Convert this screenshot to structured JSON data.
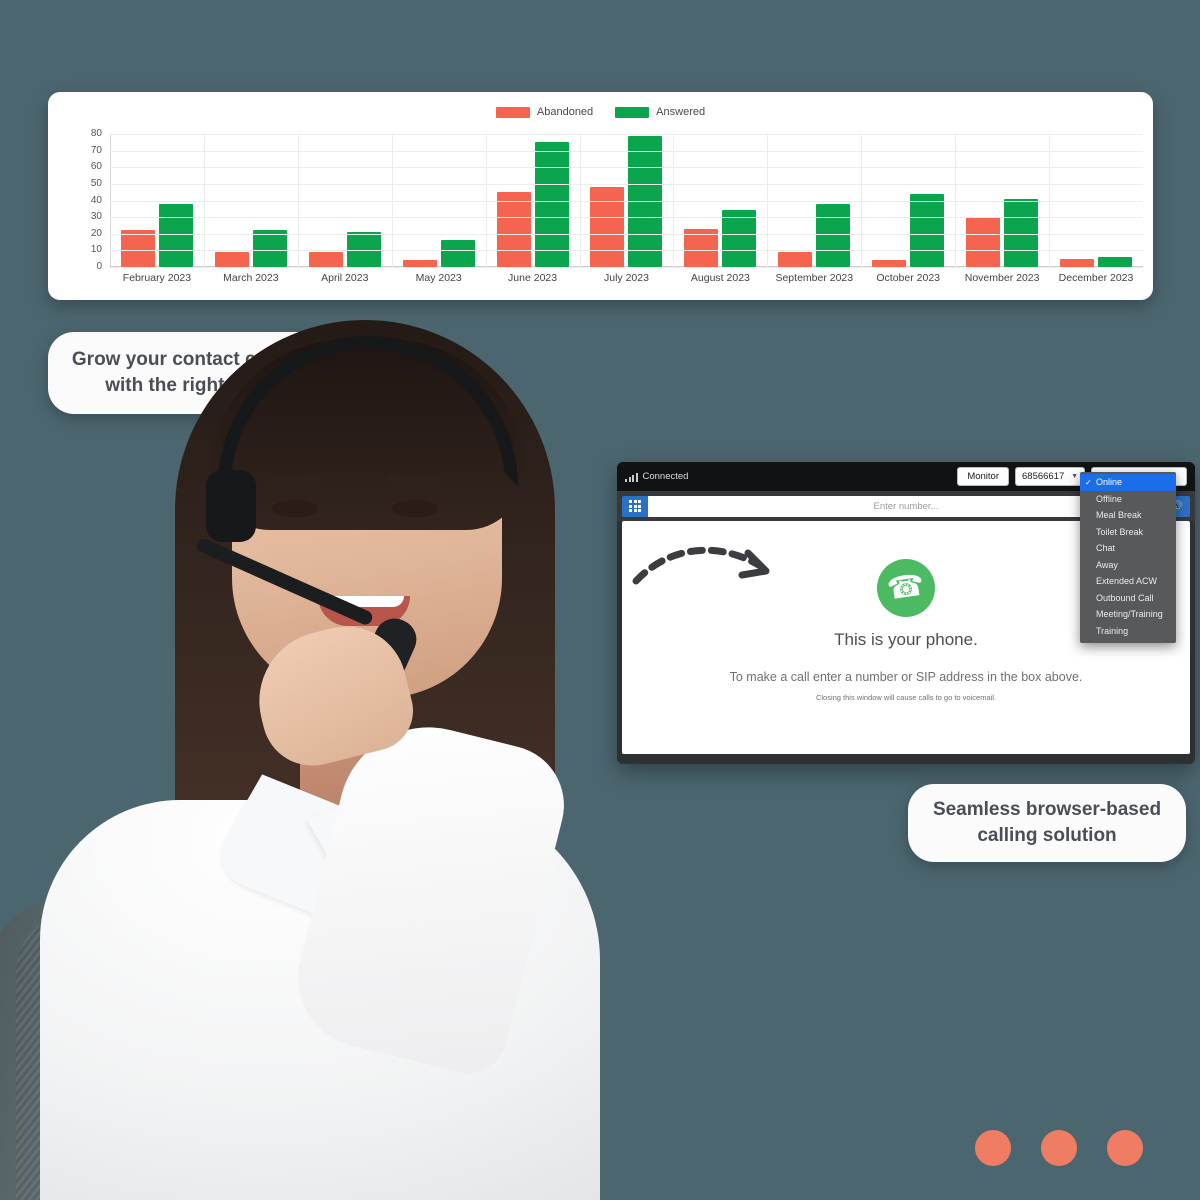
{
  "page": {
    "background_color": "#4c6670",
    "accent_color": "#ee7d63"
  },
  "chart_data": {
    "type": "bar",
    "title": "",
    "xlabel": "",
    "ylabel": "",
    "ylim": [
      0,
      80
    ],
    "ytick_values": [
      80,
      70,
      60,
      50,
      40,
      30,
      20,
      10,
      0
    ],
    "grid": true,
    "legend_position": "top-center",
    "categories": [
      "February 2023",
      "March 2023",
      "April 2023",
      "May 2023",
      "June 2023",
      "July 2023",
      "August 2023",
      "September 2023",
      "October 2023",
      "November 2023",
      "December 2023"
    ],
    "series": [
      {
        "name": "Abandoned",
        "color": "#f4644f",
        "values": [
          22,
          9,
          9,
          4,
          45,
          48,
          23,
          9,
          4,
          30,
          5
        ]
      },
      {
        "name": "Answered",
        "color": "#0ba54e",
        "values": [
          38,
          22,
          21,
          16,
          75,
          79,
          34,
          38,
          44,
          41,
          6
        ]
      }
    ]
  },
  "callouts": {
    "data_callout": "Grow your contact center with the right data",
    "calling_callout": "Seamless browser-based calling solution"
  },
  "phone": {
    "titlebar": {
      "signal_icon": "signal-bars-icon",
      "connection_label": "Connected",
      "monitor_button": "Monitor",
      "extension_value": "68566617",
      "caret_icon": "chevron-down-icon"
    },
    "toolbar": {
      "dialpad_icon": "dialpad-icon",
      "number_placeholder": "Enter number...",
      "number_value": "",
      "volume_icon": "speaker-volume-icon"
    },
    "body": {
      "phone_icon": "phone-handset-icon",
      "heading": "This is your phone.",
      "subtext": "To make a call enter a number or SIP address in the box above.",
      "note": "Closing this window will cause calls to go to voicemail.",
      "arrow_icon": "dashed-curved-arrow-icon"
    }
  },
  "status_dropdown": {
    "selected": "Online",
    "check_icon": "check-icon",
    "options": [
      "Online",
      "Offline",
      "Meal Break",
      "Toilet Break",
      "Chat",
      "Away",
      "Extended ACW",
      "Outbound Call",
      "Meeting/Training",
      "Training"
    ]
  },
  "dots": {
    "count": 3,
    "color": "#ee7d63"
  }
}
